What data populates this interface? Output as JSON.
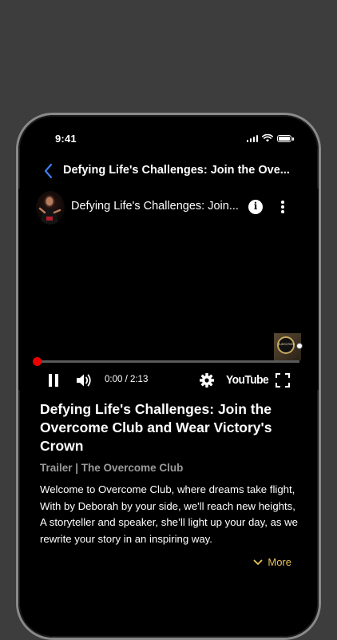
{
  "status_bar": {
    "time": "9:41"
  },
  "nav": {
    "title": "Defying Life's Challenges: Join the Ove..."
  },
  "player": {
    "video_title": "Defying Life's Challenges: Join...",
    "time_display": "0:00 / 2:13",
    "youtube_label": "YouTube",
    "progress": 0,
    "accent_color": "#ff0000"
  },
  "episode": {
    "headline": "Defying Life's Challenges: Join the Overcome Club and Wear Victory's Crown",
    "subline": "Trailer | The Overcome Club",
    "description": "Welcome to Overcome Club, where dreams take flight, With by Deborah by your side, we'll reach new heights, A storyteller and speaker, she’ll light up your day, as we rewrite your story in an inspiring way.",
    "more_label": "More",
    "more_color": "#e8c45a"
  }
}
